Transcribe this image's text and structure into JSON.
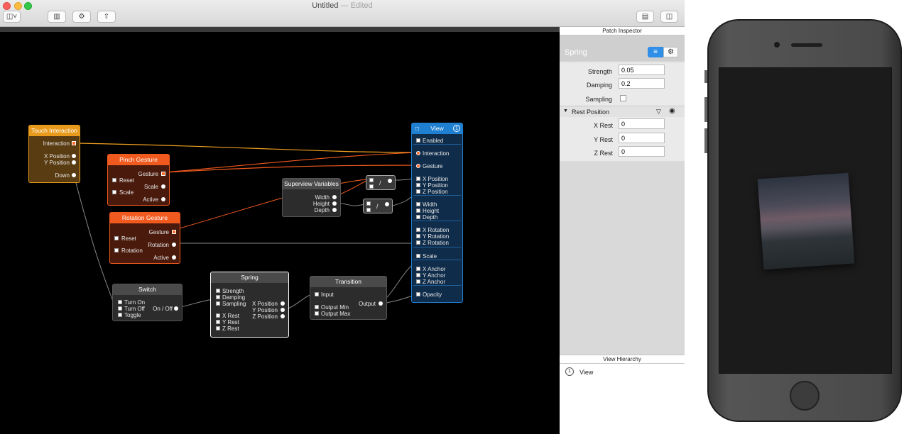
{
  "window": {
    "title": "Untitled",
    "title_suffix": "— Edited"
  },
  "canvas": {
    "patches": {
      "touch": {
        "title": "Touch Interaction",
        "rows": [
          "Interaction",
          "X Position",
          "Y Position",
          "Down"
        ]
      },
      "pinch": {
        "title": "Pinch Gesture",
        "inputs": [
          "Reset",
          "Scale"
        ],
        "outputs": [
          "Gesture",
          "Scale",
          "Active"
        ]
      },
      "rotation": {
        "title": "Rotation Gesture",
        "inputs": [
          "Reset",
          "Rotation"
        ],
        "outputs": [
          "Gesture",
          "Rotation",
          "Active"
        ]
      },
      "switch": {
        "title": "Switch",
        "inputs": [
          "Turn On",
          "Turn Off",
          "Toggle"
        ],
        "output": "On / Off"
      },
      "spring": {
        "title": "Spring",
        "inputs": [
          "Strength",
          "Damping",
          "Sampling",
          "X Rest",
          "Y Rest",
          "Z Rest"
        ],
        "outputs": [
          "X Position",
          "Y Position",
          "Z Position"
        ]
      },
      "superview": {
        "title": "Superview Variables",
        "outputs": [
          "Width",
          "Height",
          "Depth"
        ]
      },
      "divide1": {
        "op": "/"
      },
      "divide2": {
        "op": "/"
      },
      "transition": {
        "title": "Transition",
        "inputs": [
          "Input",
          "Output Min",
          "Output Max"
        ],
        "output": "Output"
      },
      "view": {
        "title": "View",
        "badge": "1",
        "inputs": [
          "Enabled",
          "Interaction",
          "Gesture",
          "X Position",
          "Y Position",
          "Z Position",
          "Width",
          "Height",
          "Depth",
          "X Rotation",
          "Y Rotation",
          "Z Rotation",
          "Scale",
          "X Anchor",
          "Y Anchor",
          "Z Anchor",
          "Opacity"
        ]
      }
    }
  },
  "inspector": {
    "header": "Patch Inspector",
    "patch_name": "Spring",
    "fields": [
      {
        "label": "Strength",
        "value": "0.05"
      },
      {
        "label": "Damping",
        "value": "0.2"
      },
      {
        "label": "Sampling",
        "value": ""
      }
    ],
    "group": {
      "label": "Rest Position",
      "fields": [
        {
          "label": "X Rest",
          "value": "0"
        },
        {
          "label": "Y Rest",
          "value": "0"
        },
        {
          "label": "Z Rest",
          "value": "0"
        }
      ]
    },
    "view_hierarchy": {
      "header": "View Hierarchy",
      "items": [
        {
          "index": "1",
          "label": "View"
        }
      ]
    }
  },
  "colors": {
    "accent": "#2e8ee8",
    "touch": "#e89a1c",
    "gesture": "#f05a1e",
    "view": "#1f7fd0"
  }
}
